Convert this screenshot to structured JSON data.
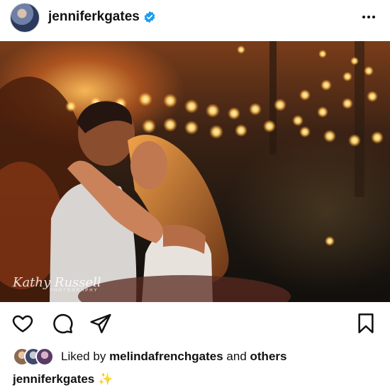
{
  "post": {
    "username": "jenniferkgates",
    "verified_icon": "verified-badge-icon",
    "more_icon": "more-options-icon",
    "colors": {
      "verified": "#1d9bf0",
      "text": "#111111",
      "background": "#ffffff"
    }
  },
  "photo": {
    "watermark_signature": "Kathy Russell",
    "watermark_sub": "PHOTOGRAPHY"
  },
  "actions": {
    "like_icon": "heart-icon",
    "comment_icon": "comment-icon",
    "share_icon": "send-icon",
    "save_icon": "bookmark-icon"
  },
  "likes": {
    "prefix": "Liked by",
    "user": "melindafrenchgates",
    "joiner": "and",
    "others": "others"
  },
  "caption": {
    "username": "jenniferkgates",
    "text": "✨"
  }
}
